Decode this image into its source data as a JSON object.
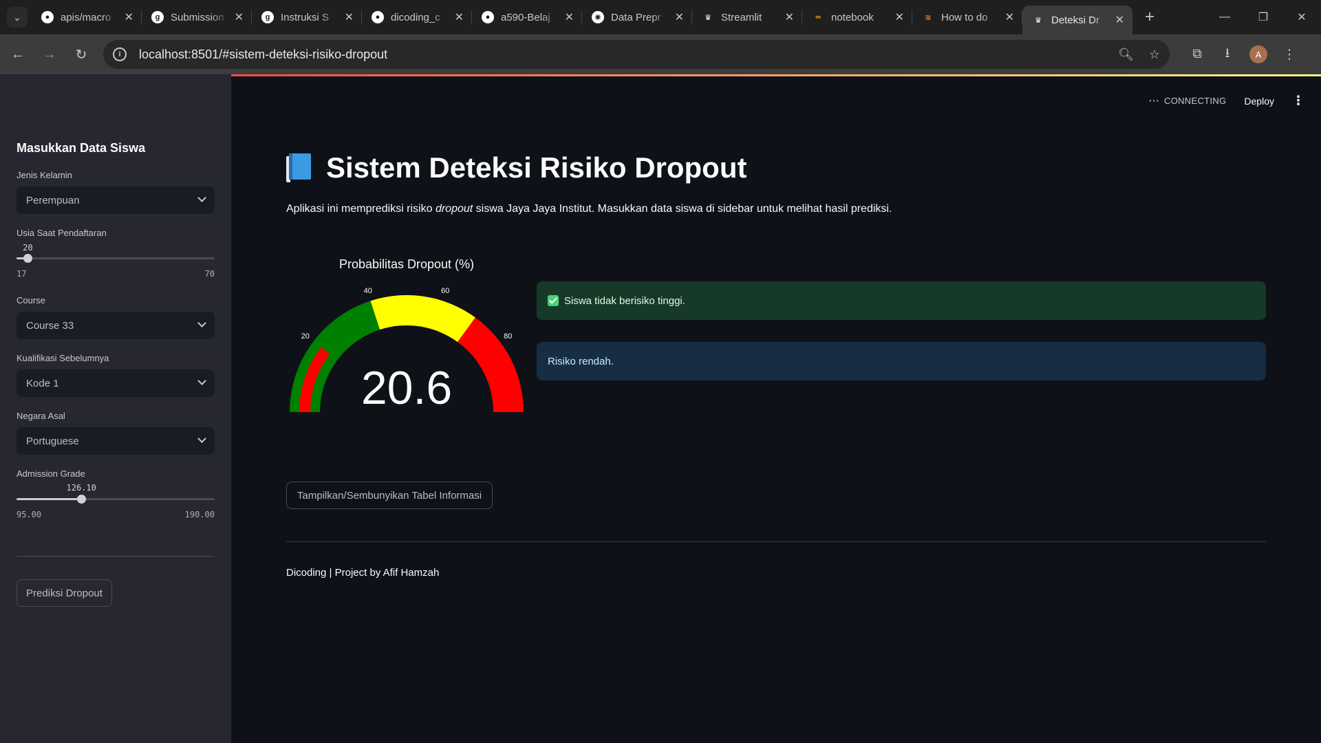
{
  "browser": {
    "tabs": [
      {
        "title": "apis/macro",
        "icon": "github-icon"
      },
      {
        "title": "Submission",
        "icon": "dicoding-icon"
      },
      {
        "title": "Instruksi S",
        "icon": "dicoding-icon"
      },
      {
        "title": "dicoding_c",
        "icon": "github-icon"
      },
      {
        "title": "a590-Belaj",
        "icon": "github-icon"
      },
      {
        "title": "Data Prepr",
        "icon": "openai-icon"
      },
      {
        "title": "Streamlit",
        "icon": "streamlit-icon"
      },
      {
        "title": "notebook",
        "icon": "colab-icon"
      },
      {
        "title": "How to do",
        "icon": "stackoverflow-icon"
      },
      {
        "title": "Deteksi Dr",
        "icon": "streamlit-icon",
        "active": true
      }
    ],
    "url": "localhost:8501/#sistem-deteksi-risiko-dropout",
    "avatar_letter": "A"
  },
  "header": {
    "status": "CONNECTING",
    "deploy_label": "Deploy"
  },
  "sidebar": {
    "title": "Masukkan Data Siswa",
    "gender": {
      "label": "Jenis Kelamin",
      "value": "Perempuan"
    },
    "age": {
      "label": "Usia Saat Pendaftaran",
      "value": "20",
      "min": "17",
      "max": "70",
      "fraction": 0.057
    },
    "course": {
      "label": "Course",
      "value": "Course 33"
    },
    "qualification": {
      "label": "Kualifikasi Sebelumnya",
      "value": "Kode 1"
    },
    "nationality": {
      "label": "Negara Asal",
      "value": "Portuguese"
    },
    "admission": {
      "label": "Admission Grade",
      "value": "126.10",
      "min": "95.00",
      "max": "190.00",
      "fraction": 0.327
    },
    "predict_button": "Prediksi Dropout"
  },
  "main": {
    "title": "Sistem Deteksi Risiko Dropout",
    "intro_before": "Aplikasi ini memprediksi risiko ",
    "intro_em": "dropout",
    "intro_after": " siswa Jaya Jaya Institut. Masukkan data siswa di sidebar untuk melihat hasil prediksi.",
    "success_message": "Siswa tidak berisiko tinggi.",
    "info_message": "Risiko rendah.",
    "toggle_button": "Tampilkan/Sembunyikan Tabel Informasi",
    "footer": "Dicoding | Project by Afif Hamzah"
  },
  "gauge": {
    "title": "Probabilitas Dropout (%)",
    "value": 20.6,
    "value_label": "20.6",
    "range": [
      0,
      100
    ],
    "ticks": [
      "20",
      "40",
      "60",
      "80"
    ],
    "steps": [
      {
        "range": [
          0,
          40
        ],
        "color": "#008000"
      },
      {
        "range": [
          40,
          70
        ],
        "color": "#ffff00"
      },
      {
        "range": [
          70,
          100
        ],
        "color": "#ff0000"
      }
    ],
    "bar_color": "#ff0000"
  },
  "colors": {
    "app_bg": "#0e1117",
    "sidebar_bg": "#262730",
    "success_bg": "#173928",
    "info_bg": "#172d43"
  }
}
